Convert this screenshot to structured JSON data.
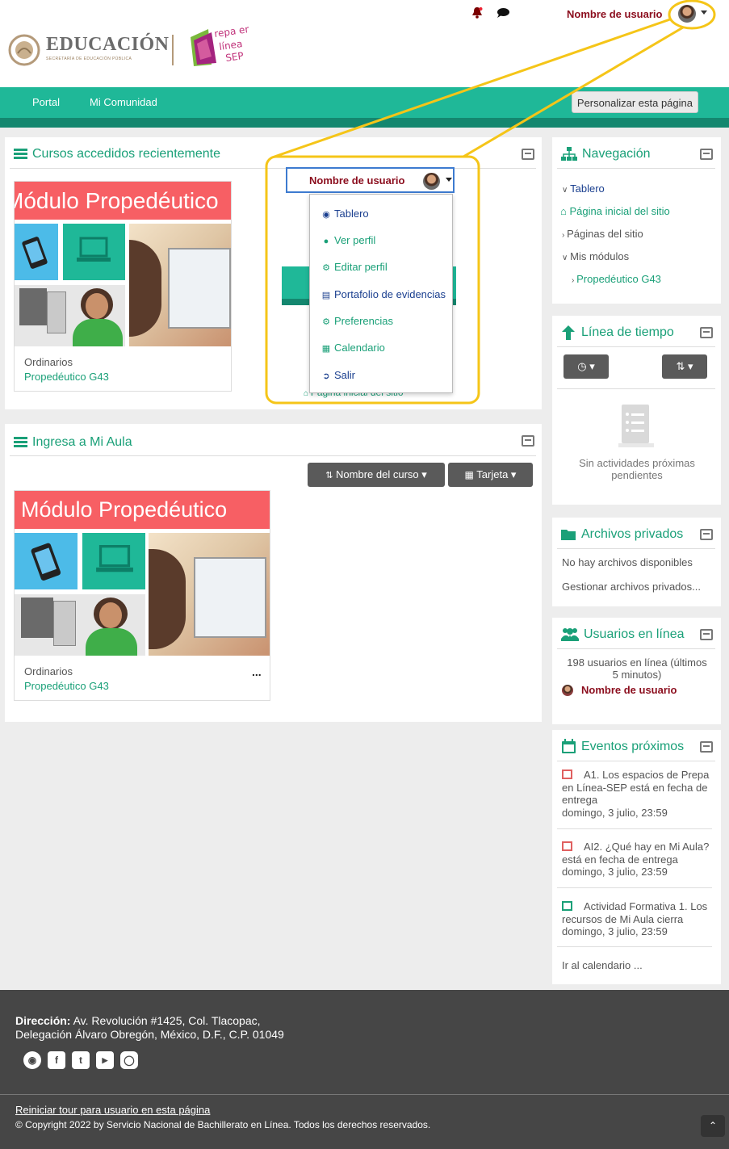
{
  "header": {
    "user_name": "Nombre de usuario",
    "logo_text": "EDUCACIÓN",
    "logo_subtitle": "SECRETARÍA DE EDUCACIÓN PÚBLICA",
    "prepa_logo_text": "Prepa en línea SEP"
  },
  "navbar": {
    "items": [
      {
        "label": "Portal"
      },
      {
        "label": "Mi Comunidad"
      }
    ],
    "customize_label": "Personalizar esta página"
  },
  "recent_courses": {
    "title": "Cursos accedidos recientemente",
    "course": {
      "banner": "Módulo Propedéutico",
      "category": "Ordinarios",
      "name": "Propedéutico G43"
    }
  },
  "user_menu": {
    "trigger_label": "Nombre de usuario",
    "items": [
      {
        "label": "Tablero",
        "icon": "dashboard-icon"
      },
      {
        "label": "Ver perfil",
        "icon": "user-icon"
      },
      {
        "label": "Editar perfil",
        "icon": "cog-icon"
      },
      {
        "label": "Portafolio de evidencias",
        "icon": "portfolio-icon"
      },
      {
        "label": "Preferencias",
        "icon": "wrench-icon"
      },
      {
        "label": "Calendario",
        "icon": "calendar-icon"
      },
      {
        "label": "Salir",
        "icon": "sign-out-icon"
      }
    ],
    "peek_text": "Página inicial del sitio"
  },
  "my_courses": {
    "title": "Ingresa a Mi Aula",
    "sort_label": "Nombre del curso",
    "view_label": "Tarjeta",
    "course": {
      "banner": "Módulo Propedéutico",
      "category": "Ordinarios",
      "name": "Propedéutico G43",
      "menu": "..."
    }
  },
  "navigation": {
    "title": "Navegación",
    "items": [
      {
        "label": "Tablero",
        "prefix": "v"
      },
      {
        "label": "Página inicial del sitio",
        "prefix": "home"
      },
      {
        "label": "Páginas del sitio",
        "prefix": ">"
      },
      {
        "label": "Mis módulos",
        "prefix": "v"
      },
      {
        "label": "Propedéutico G43",
        "prefix": ">"
      }
    ]
  },
  "timeline": {
    "title": "Línea de tiempo",
    "empty_text": "Sin actividades próximas pendientes"
  },
  "private_files": {
    "title": "Archivos privados",
    "empty_text": "No hay archivos disponibles",
    "manage_label": "Gestionar archivos privados..."
  },
  "online_users": {
    "title": "Usuarios en línea",
    "summary": "198 usuarios en línea (últimos 5 minutos)",
    "user_name": "Nombre de usuario"
  },
  "events": {
    "title": "Eventos próximos",
    "items": [
      {
        "title": "A1. Los espacios de Prepa en Línea-SEP está en fecha de entrega",
        "date": "domingo, 3 julio, 23:59"
      },
      {
        "title": "AI2. ¿Qué hay en Mi Aula? está en fecha de entrega",
        "date": "domingo, 3 julio, 23:59"
      },
      {
        "title": "Actividad Formativa 1. Los recursos de Mi Aula cierra",
        "date": "domingo, 3 julio, 23:59"
      }
    ],
    "calendar_link": "Ir al calendario ..."
  },
  "footer": {
    "address_label": "Dirección:",
    "address_line1": "Av. Revolución #1425, Col. Tlacopac,",
    "address_line2": "Delegación Álvaro Obregón, México, D.F., C.P. 01049",
    "tour_link": "Reiniciar tour para usuario en esta página",
    "copyright": "© Copyright 2022 by Servicio Nacional de Bachillerato en Línea. Todos los derechos reservados."
  },
  "colors": {
    "accent": "#1fb898",
    "highlight": "#f5c518",
    "brand_red": "#8b0d1d",
    "banner": "#f75f64"
  }
}
